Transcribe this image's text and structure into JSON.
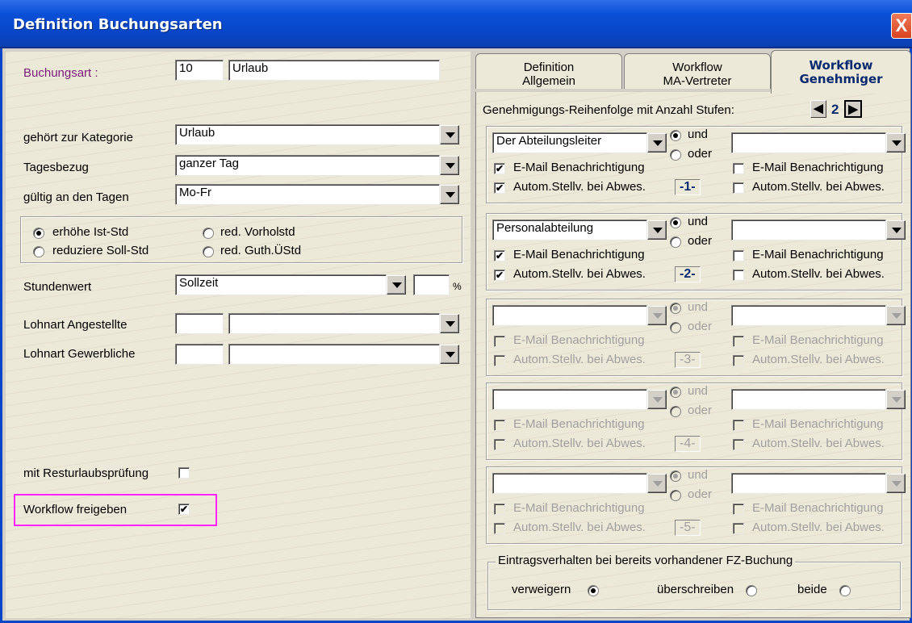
{
  "window": {
    "title": "Definition Buchungsarten",
    "close_glyph": "X"
  },
  "left": {
    "buchungsart_label": "Buchungsart :",
    "buchungsart_code": "10",
    "buchungsart_name": "Urlaub",
    "kategorie_label": "gehört zur Kategorie",
    "kategorie_value": "Urlaub",
    "tagesbezug_label": "Tagesbezug",
    "tagesbezug_value": "ganzer Tag",
    "gueltig_label": "gültig an den Tagen",
    "gueltig_value": "Mo-Fr",
    "radios": [
      "erhöhe Ist-Std",
      "red. Vorholstd",
      "reduziere Soll-Std",
      "red. Guth.ÜStd"
    ],
    "radio_selected": 0,
    "stundenwert_label": "Stundenwert",
    "stundenwert_value": "Sollzeit",
    "percent_value": "",
    "percent_sign": "%",
    "lohnart_angestellte_label": "Lohnart Angestellte",
    "lohnart_angestellte_code": "",
    "lohnart_angestellte_name": "",
    "lohnart_gewerbliche_label": "Lohnart Gewerbliche",
    "lohnart_gewerbliche_code": "",
    "lohnart_gewerbliche_name": "",
    "resturlaub_label": "mit Resturlaubsprüfung",
    "resturlaub_checked": false,
    "workflow_label": "Workflow freigeben",
    "workflow_checked": true
  },
  "tabs": [
    {
      "line1": "Definition",
      "line2": "Allgemein"
    },
    {
      "line1": "Workflow",
      "line2": "MA-Vertreter"
    },
    {
      "line1": "Workflow",
      "line2": "Genehmiger"
    }
  ],
  "active_tab": 2,
  "workflow": {
    "header_label": "Genehmigungs-Reihenfolge mit Anzahl Stufen:",
    "stufen_count": "2",
    "und_label": "und",
    "oder_label": "oder",
    "email_label": "E-Mail Benachrichtigung",
    "autom_label": "Autom.Stellv. bei Abwes.",
    "stages": [
      {
        "number": "-1-",
        "left_value": "Der Abteilungsleiter",
        "right_value": "",
        "enabled": true,
        "email_left": true,
        "autom_left": true,
        "email_right": false,
        "autom_right": false,
        "und_selected": true
      },
      {
        "number": "-2-",
        "left_value": "Personalabteilung",
        "right_value": "",
        "enabled": true,
        "email_left": true,
        "autom_left": true,
        "email_right": false,
        "autom_right": false,
        "und_selected": true
      },
      {
        "number": "-3-",
        "left_value": "",
        "right_value": "",
        "enabled": false,
        "email_left": false,
        "autom_left": false,
        "email_right": false,
        "autom_right": false,
        "und_selected": true
      },
      {
        "number": "-4-",
        "left_value": "",
        "right_value": "",
        "enabled": false,
        "email_left": false,
        "autom_left": false,
        "email_right": false,
        "autom_right": false,
        "und_selected": true
      },
      {
        "number": "-5-",
        "left_value": "",
        "right_value": "",
        "enabled": false,
        "email_left": false,
        "autom_left": false,
        "email_right": false,
        "autom_right": false,
        "und_selected": true
      }
    ],
    "eintrag_legend": "Eintragsverhalten bei bereits vorhandener FZ-Buchung",
    "eintrag_options": [
      "verweigern",
      "überschreiben",
      "beide"
    ],
    "eintrag_selected": 0
  },
  "colors": {
    "titlebar": "#0846c8",
    "highlight": "#ff22ff",
    "label_purple": "#7a1a7a"
  }
}
